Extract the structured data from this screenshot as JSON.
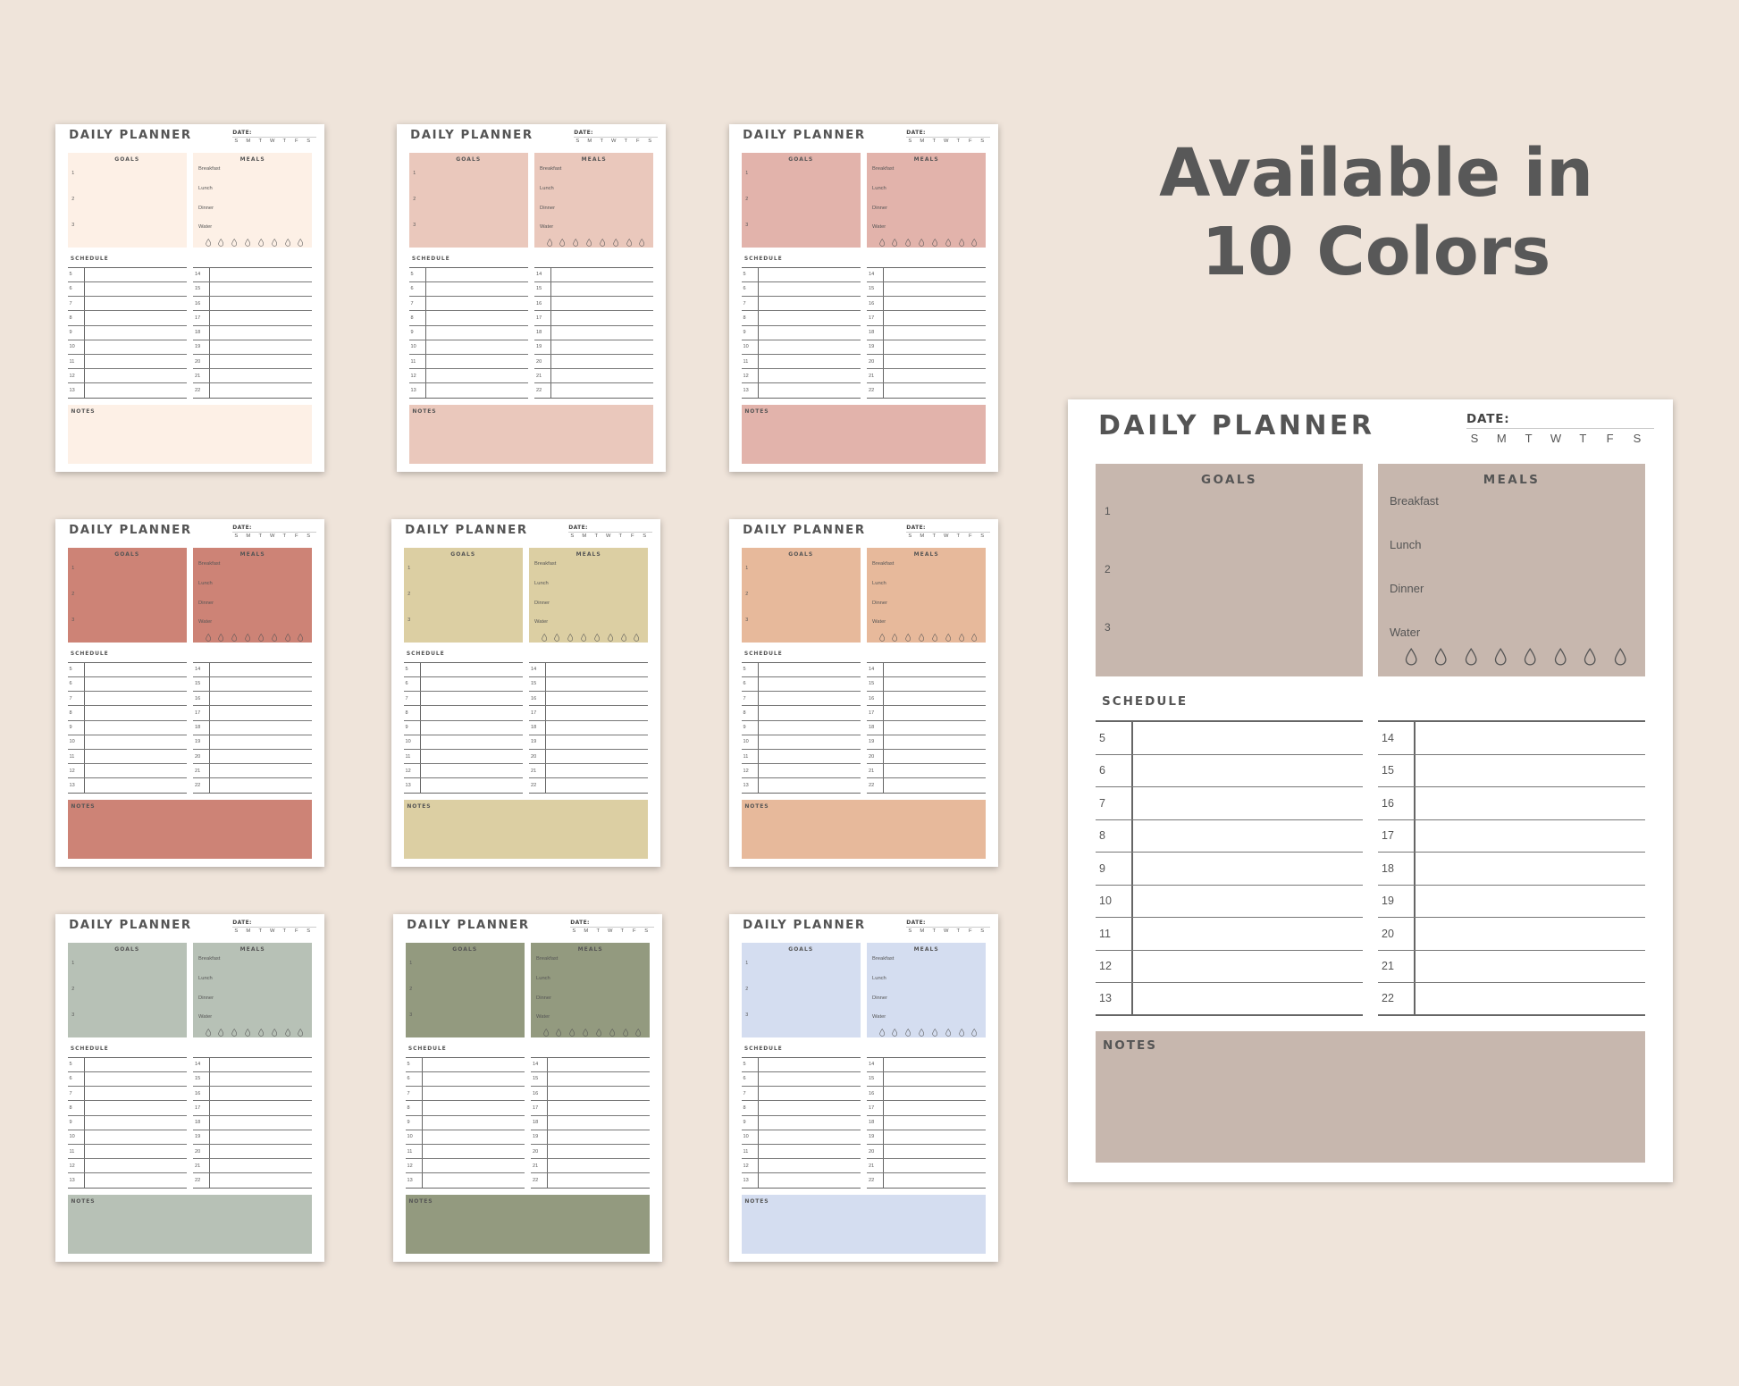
{
  "headline": {
    "line1": "Available in",
    "line2": "10 Colors"
  },
  "planner_text": {
    "title": "DAILY PLANNER",
    "date_label": "DATE:",
    "days": [
      "S",
      "M",
      "T",
      "W",
      "T",
      "F",
      "S"
    ],
    "goals_title": "GOALS",
    "goal_numbers": [
      "1",
      "2",
      "3"
    ],
    "meals_title": "MEALS",
    "meals": [
      "Breakfast",
      "Lunch",
      "Dinner",
      "Water"
    ],
    "water_drops": 8,
    "schedule_title": "SCHEDULE",
    "schedule_left": [
      "5",
      "6",
      "7",
      "8",
      "9",
      "10",
      "11",
      "12",
      "13"
    ],
    "schedule_right": [
      "14",
      "15",
      "16",
      "17",
      "18",
      "19",
      "20",
      "21",
      "22"
    ],
    "notes_title": "NOTES"
  },
  "colors": {
    "background": "#efe4da",
    "headline": "#585858",
    "variants": [
      "#fdf0e6",
      "#eac8bc",
      "#e2b3ab",
      "#cd8376",
      "#dccfa3",
      "#e7b99b",
      "#b7c1b6",
      "#939a7f",
      "#d4ddf0",
      "#c7b7ae"
    ]
  }
}
